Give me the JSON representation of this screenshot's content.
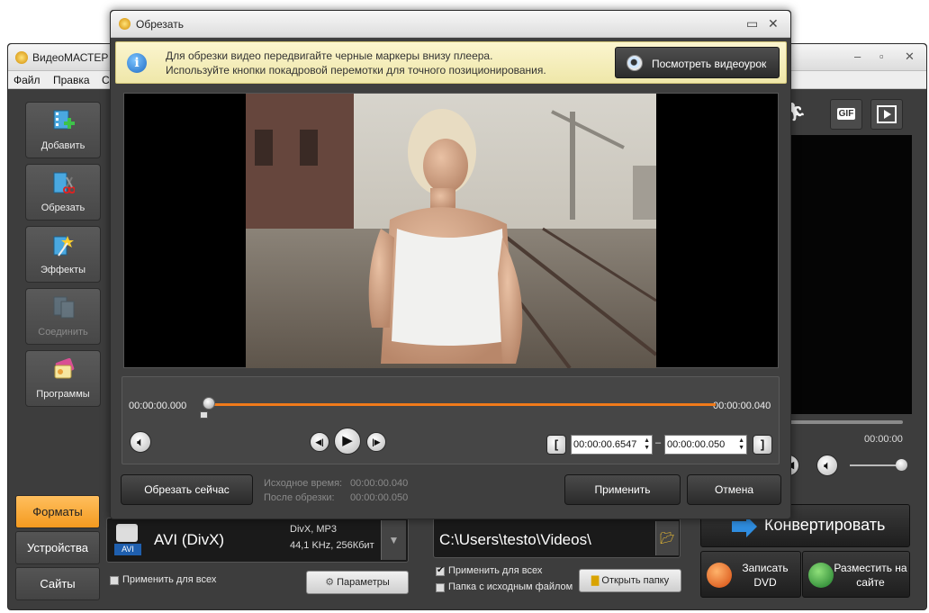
{
  "main_window": {
    "title": "ВидеоМАСТЕР",
    "menu": [
      "Файл",
      "Правка",
      "С"
    ],
    "controls": {
      "minimize": "–",
      "maximize": "▫",
      "close": "✕"
    },
    "tools": [
      {
        "label": "Добавить",
        "icon": "film-add-icon"
      },
      {
        "label": "Обрезать",
        "icon": "film-cut-icon"
      },
      {
        "label": "Эффекты",
        "icon": "magic-wand-icon"
      },
      {
        "label": "Соединить",
        "icon": "film-join-icon",
        "disabled": true
      },
      {
        "label": "Программы",
        "icon": "programs-icon"
      }
    ],
    "right_panel": {
      "gif_label": "GIF",
      "time": "00:00:00"
    },
    "tabs": [
      "Форматы",
      "Устройства",
      "Сайты"
    ],
    "format": {
      "name": "AVI (DivX)",
      "badge": "AVI",
      "detail_line1": "DivX, MP3",
      "detail_line2": "44,1 KHz, 256Кбит",
      "apply_all": "Применить для всех",
      "params_button": "Параметры"
    },
    "output": {
      "path": "C:\\Users\\testo\\Videos\\",
      "apply_all": "Применить для всех",
      "source_folder": "Папка с исходным файлом",
      "open_folder_button": "Открыть папку"
    },
    "convert_button": "Конвертировать",
    "dvd_button": "Записать DVD",
    "web_button": "Разместить на сайте"
  },
  "dialog": {
    "title": "Обрезать",
    "info_line1": "Для обрезки видео передвигайте черные маркеры внизу плеера.",
    "info_line2": "Используйте кнопки покадровой перемотки для точного позиционирования.",
    "tutorial_button": "Посмотреть видеоурок",
    "time_start": "00:00:00.000",
    "time_end": "00:00:00.040",
    "trim_start_value": "00:00:00.6547",
    "trim_separator": "–",
    "trim_end_value": "00:00:00.050",
    "cut_now_button": "Обрезать сейчас",
    "source_time_label": "Исходное время:",
    "source_time_value": "00:00:00.040",
    "after_cut_label": "После обрезки:",
    "after_cut_value": "00:00:00.050",
    "apply_button": "Применить",
    "cancel_button": "Отмена",
    "colors": {
      "track": "#f07a1a",
      "info_bg": "#f6efbd",
      "active_tab": "#f7a733"
    }
  }
}
